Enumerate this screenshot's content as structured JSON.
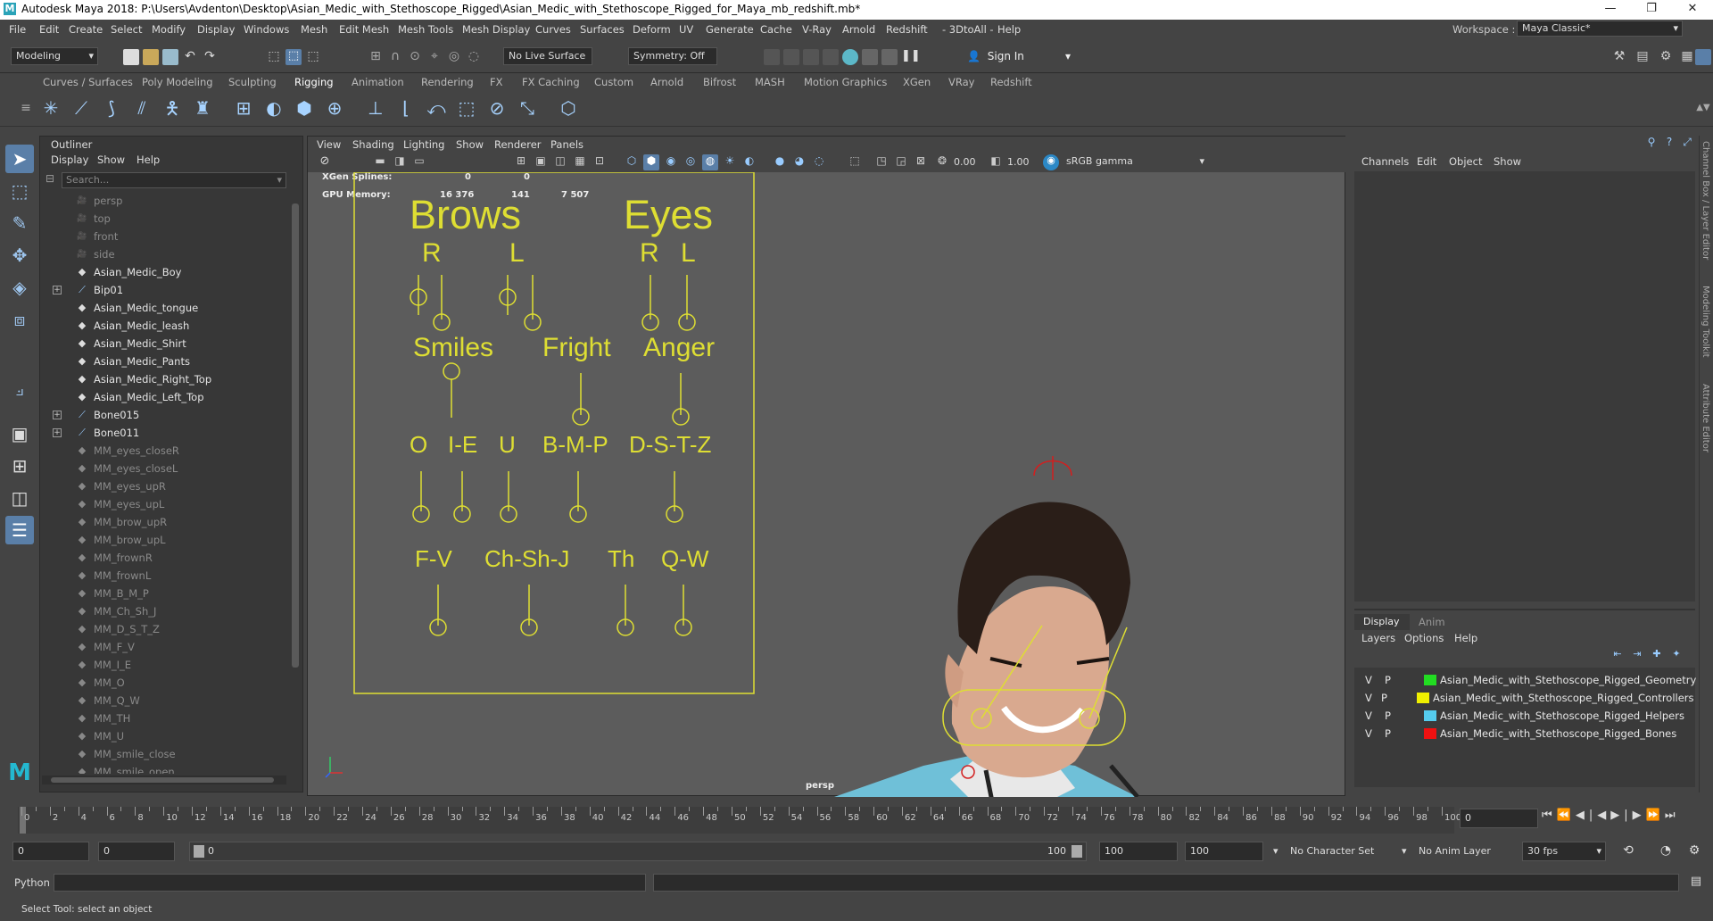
{
  "window": {
    "title": "Autodesk Maya 2018: P:\\Users\\Avdenton\\Desktop\\Asian_Medic_with_Stethoscope_Rigged\\Asian_Medic_with_Stethoscope_Rigged_for_Maya_mb_redshift.mb*",
    "minimize": "—",
    "maximize": "❐",
    "close": "✕"
  },
  "menubar": [
    "File",
    "Edit",
    "Create",
    "Select",
    "Modify",
    "Display",
    "Windows",
    "Mesh",
    "Edit Mesh",
    "Mesh Tools",
    "Mesh Display",
    "Curves",
    "Surfaces",
    "Deform",
    "UV",
    "Generate",
    "Cache",
    "V-Ray",
    "Arnold",
    "Redshift",
    "- 3DtoAll -",
    "Help"
  ],
  "workspace": {
    "label": "Workspace :",
    "value": "Maya Classic*"
  },
  "status": {
    "mode": "Modeling",
    "live_surface": "No Live Surface",
    "symmetry": "Symmetry: Off",
    "sign_in": "Sign In"
  },
  "shelf_tabs": [
    "Curves / Surfaces",
    "Poly Modeling",
    "Sculpting",
    "Rigging",
    "Animation",
    "Rendering",
    "FX",
    "FX Caching",
    "Custom",
    "Arnold",
    "Bifrost",
    "MASH",
    "Motion Graphics",
    "XGen",
    "VRay",
    "Redshift"
  ],
  "shelf_active": "Rigging",
  "outliner": {
    "title": "Outliner",
    "menu": [
      "Display",
      "Show",
      "Help"
    ],
    "search_placeholder": "Search...",
    "items": [
      {
        "name": "persp",
        "type": "camera",
        "style": "grey"
      },
      {
        "name": "top",
        "type": "camera",
        "style": "grey"
      },
      {
        "name": "front",
        "type": "camera",
        "style": "grey"
      },
      {
        "name": "side",
        "type": "camera",
        "style": "grey"
      },
      {
        "name": "Asian_Medic_Boy",
        "type": "mesh",
        "style": "white"
      },
      {
        "name": "Bip01",
        "type": "joint",
        "style": "white",
        "expand": true
      },
      {
        "name": "Asian_Medic_tongue",
        "type": "mesh",
        "style": "white"
      },
      {
        "name": "Asian_Medic_leash",
        "type": "mesh",
        "style": "white"
      },
      {
        "name": "Asian_Medic_Shirt",
        "type": "mesh",
        "style": "white"
      },
      {
        "name": "Asian_Medic_Pants",
        "type": "mesh",
        "style": "white"
      },
      {
        "name": "Asian_Medic_Right_Top",
        "type": "mesh",
        "style": "white"
      },
      {
        "name": "Asian_Medic_Left_Top",
        "type": "mesh",
        "style": "white"
      },
      {
        "name": "Bone015",
        "type": "joint",
        "style": "white",
        "expand": true
      },
      {
        "name": "Bone011",
        "type": "joint",
        "style": "white",
        "expand": true
      },
      {
        "name": "MM_eyes_closeR",
        "type": "mesh",
        "style": "grey"
      },
      {
        "name": "MM_eyes_closeL",
        "type": "mesh",
        "style": "grey"
      },
      {
        "name": "MM_eyes_upR",
        "type": "mesh",
        "style": "grey"
      },
      {
        "name": "MM_eyes_upL",
        "type": "mesh",
        "style": "grey"
      },
      {
        "name": "MM_brow_upR",
        "type": "mesh",
        "style": "grey"
      },
      {
        "name": "MM_brow_upL",
        "type": "mesh",
        "style": "grey"
      },
      {
        "name": "MM_frownR",
        "type": "mesh",
        "style": "grey"
      },
      {
        "name": "MM_frownL",
        "type": "mesh",
        "style": "grey"
      },
      {
        "name": "MM_B_M_P",
        "type": "mesh",
        "style": "grey"
      },
      {
        "name": "MM_Ch_Sh_J",
        "type": "mesh",
        "style": "grey"
      },
      {
        "name": "MM_D_S_T_Z",
        "type": "mesh",
        "style": "grey"
      },
      {
        "name": "MM_F_V",
        "type": "mesh",
        "style": "grey"
      },
      {
        "name": "MM_I_E",
        "type": "mesh",
        "style": "grey"
      },
      {
        "name": "MM_O",
        "type": "mesh",
        "style": "grey"
      },
      {
        "name": "MM_Q_W",
        "type": "mesh",
        "style": "grey"
      },
      {
        "name": "MM_TH",
        "type": "mesh",
        "style": "grey"
      },
      {
        "name": "MM_U",
        "type": "mesh",
        "style": "grey"
      },
      {
        "name": "MM_smile_close",
        "type": "mesh",
        "style": "grey"
      },
      {
        "name": "MM_smile_open",
        "type": "mesh",
        "style": "grey"
      }
    ]
  },
  "viewport": {
    "menu": [
      "View",
      "Shading",
      "Lighting",
      "Show",
      "Renderer",
      "Panels"
    ],
    "exposure": "0.00",
    "gamma": "1.00",
    "color_space": "sRGB gamma",
    "hud": {
      "xgen_label": "XGen Splines:",
      "xgen_v1": "0",
      "xgen_v2": "0",
      "gpu_label": "GPU Memory:",
      "gpu_v1": "16 376",
      "gpu_v2": "141",
      "gpu_v3": "7 507"
    },
    "camera_label": "persp",
    "controls": {
      "brows": "Brows",
      "eyes": "Eyes",
      "r1": "R",
      "l1": "L",
      "r2": "R",
      "l2": "L",
      "smiles": "Smiles",
      "fright": "Fright",
      "anger": "Anger",
      "o": "O",
      "ie": "I-E",
      "u": "U",
      "bmp": "B-M-P",
      "dstz": "D-S-T-Z",
      "fv": "F-V",
      "chshj": "Ch-Sh-J",
      "th": "Th",
      "qw": "Q-W"
    }
  },
  "channelbox": {
    "menu": [
      "Channels",
      "Edit",
      "Object",
      "Show"
    ],
    "layer_tabs": [
      "Display",
      "Anim"
    ],
    "layer_menu": [
      "Layers",
      "Options",
      "Help"
    ],
    "layers": [
      {
        "v": "V",
        "p": "P",
        "name": "Asian_Medic_with_Stethoscope_Rigged_Geometry",
        "color": "#22dd22"
      },
      {
        "v": "V",
        "p": "P",
        "name": "Asian_Medic_with_Stethoscope_Rigged_Controllers",
        "color": "#f0f000"
      },
      {
        "v": "V",
        "p": "P",
        "name": "Asian_Medic_with_Stethoscope_Rigged_Helpers",
        "color": "#55ccee"
      },
      {
        "v": "V",
        "p": "P",
        "name": "Asian_Medic_with_Stethoscope_Rigged_Bones",
        "color": "#ee1111"
      }
    ],
    "side_tabs": [
      "Channel Box / Layer Editor",
      "Modeling Toolkit",
      "Attribute Editor"
    ]
  },
  "timeline": {
    "ticks": [
      "0",
      "2",
      "4",
      "6",
      "8",
      "10",
      "12",
      "14",
      "16",
      "18",
      "20",
      "22",
      "24",
      "26",
      "28",
      "30",
      "32",
      "34",
      "36",
      "38",
      "40",
      "42",
      "44",
      "46",
      "48",
      "50",
      "52",
      "54",
      "56",
      "58",
      "60",
      "62",
      "64",
      "66",
      "68",
      "70",
      "72",
      "74",
      "76",
      "78",
      "80",
      "82",
      "84",
      "86",
      "88",
      "90",
      "92",
      "94",
      "96",
      "98",
      "100"
    ],
    "current_frame": "0"
  },
  "range": {
    "start": "0",
    "anim_start": "0",
    "range_start": "0",
    "range_end": "100",
    "anim_end": "100",
    "end": "100",
    "character_set": "No Character Set",
    "anim_layer": "No Anim Layer",
    "fps": "30 fps"
  },
  "command": {
    "label": "Python"
  },
  "help_line": "Select Tool: select an object"
}
